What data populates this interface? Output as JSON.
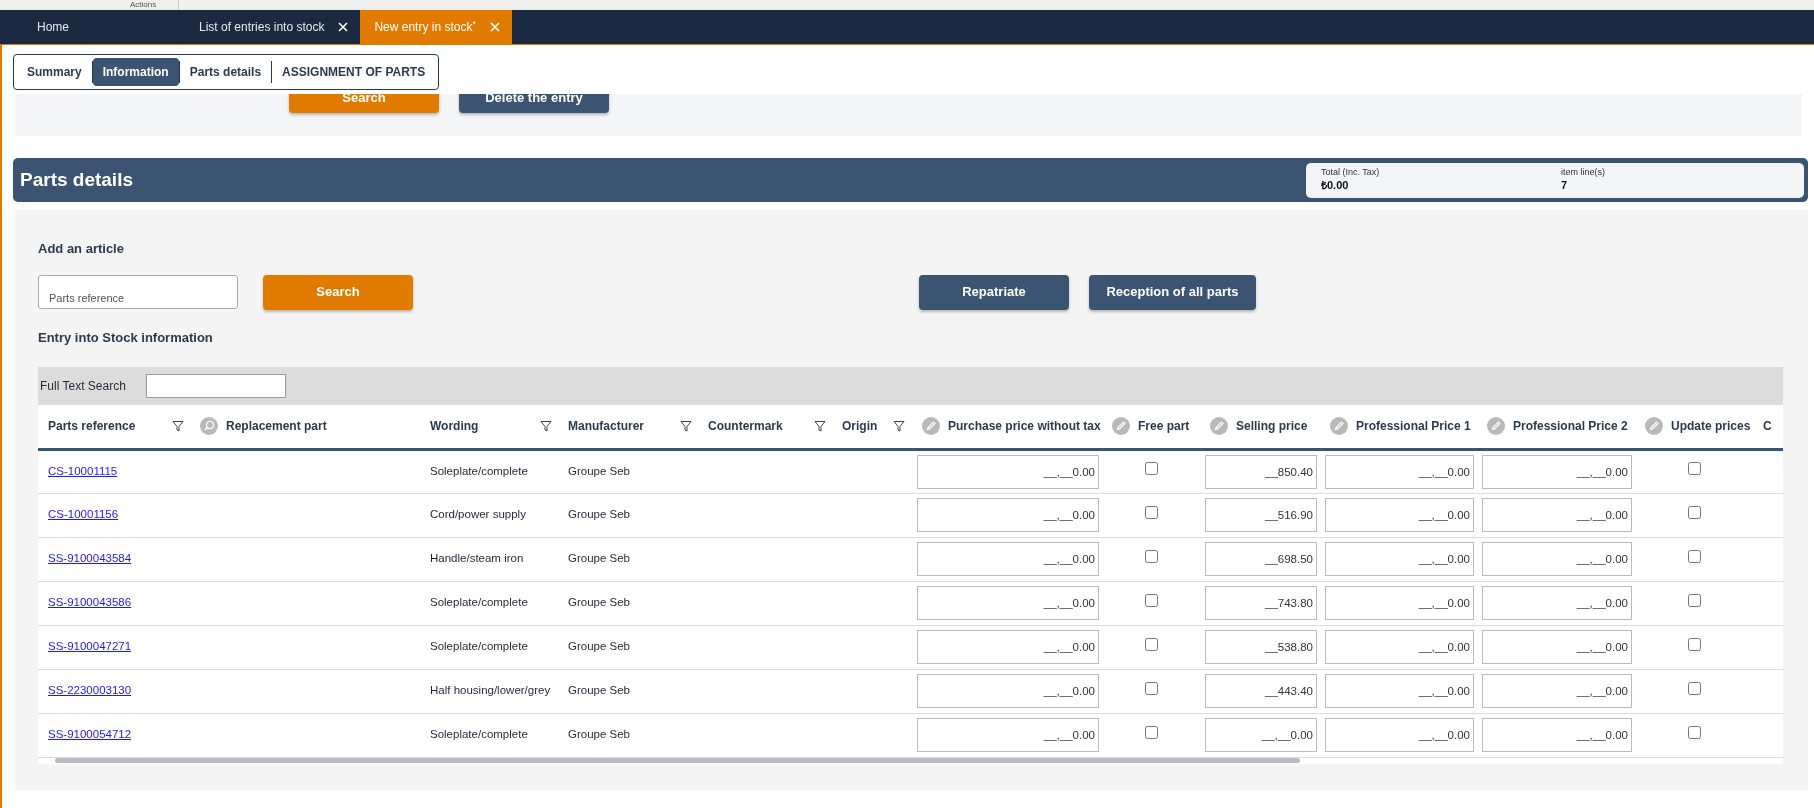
{
  "top_strip": {
    "label": "Actions"
  },
  "tabs": [
    {
      "label": "Home",
      "closable": false,
      "selected": false
    },
    {
      "label": "List of entries into stock",
      "closable": true,
      "selected": false
    },
    {
      "label": "New entry in stock$^{*}$",
      "closable": true,
      "selected": true
    }
  ],
  "section_nav": [
    {
      "label": "Summary",
      "selected": false
    },
    {
      "label": "Information",
      "selected": true
    },
    {
      "label": "Parts details",
      "selected": false
    },
    {
      "label": "ASSIGNMENT OF PARTS",
      "selected": false
    }
  ],
  "top_actions": [
    {
      "label": "Search",
      "kind": "primary"
    },
    {
      "label": "Delete the entry",
      "kind": "secondary"
    }
  ],
  "parts_details": {
    "title": "Parts details",
    "summary": [
      {
        "label": "Total (Inc. Tax)",
        "value": "₺0.00"
      },
      {
        "label": "item line(s)",
        "value": "7"
      }
    ]
  },
  "add_article": {
    "title": "Add an article",
    "field": {
      "placeholder": "Parts reference"
    },
    "search_button": "Search",
    "buttons": [
      "Repatriate",
      "Reception of all parts"
    ]
  },
  "grid": {
    "title": "Entry into Stock information",
    "full_text_search": {
      "label": "Full Text Search"
    },
    "columns": [
      {
        "label": "Parts reference",
        "kind": "filterable"
      },
      {
        "label": "Replacement part",
        "kind": "lookup"
      },
      {
        "label": "Wording",
        "kind": "filterable"
      },
      {
        "label": "Manufacturer",
        "kind": "filterable"
      },
      {
        "label": "Countermark",
        "kind": "filterable"
      },
      {
        "label": "Origin",
        "kind": "filterable"
      },
      {
        "label": "Purchase price without tax",
        "kind": "editable"
      },
      {
        "label": "Free part",
        "kind": "editable"
      },
      {
        "label": "Selling price",
        "kind": "editable"
      },
      {
        "label": "Professional Price 1",
        "kind": "editable"
      },
      {
        "label": "Professional Price 2",
        "kind": "editable"
      },
      {
        "label": "Update prices",
        "kind": "editable"
      },
      {
        "label": "C",
        "kind": "plain"
      }
    ],
    "rows": [
      {
        "parts_reference": "CS-10001115",
        "wording": "Soleplate/complete",
        "manufacturer": "Groupe Seb",
        "purchase_price": "__,__0.00",
        "free_part": false,
        "selling_price": "__850.40",
        "professional_price_1": "__,__0.00",
        "professional_price_2": "__,__0.00",
        "update_prices": false
      },
      {
        "parts_reference": "CS-10001156",
        "wording": "Cord/power supply",
        "manufacturer": "Groupe Seb",
        "purchase_price": "__,__0.00",
        "free_part": false,
        "selling_price": "__516.90",
        "professional_price_1": "__,__0.00",
        "professional_price_2": "__,__0.00",
        "update_prices": false
      },
      {
        "parts_reference": "SS-9100043584",
        "wording": "Handle/steam iron",
        "manufacturer": "Groupe Seb",
        "purchase_price": "__,__0.00",
        "free_part": false,
        "selling_price": "__698.50",
        "professional_price_1": "__,__0.00",
        "professional_price_2": "__,__0.00",
        "update_prices": false
      },
      {
        "parts_reference": "SS-9100043586",
        "wording": "Soleplate/complete",
        "manufacturer": "Groupe Seb",
        "purchase_price": "__,__0.00",
        "free_part": false,
        "selling_price": "__743.80",
        "professional_price_1": "__,__0.00",
        "professional_price_2": "__,__0.00",
        "update_prices": false
      },
      {
        "parts_reference": "SS-9100047271",
        "wording": "Soleplate/complete",
        "manufacturer": "Groupe Seb",
        "purchase_price": "__,__0.00",
        "free_part": false,
        "selling_price": "__538.80",
        "professional_price_1": "__,__0.00",
        "professional_price_2": "__,__0.00",
        "update_prices": false
      },
      {
        "parts_reference": "SS-2230003130",
        "wording": "Half housing/lower/grey",
        "manufacturer": "Groupe Seb",
        "purchase_price": "__,__0.00",
        "free_part": false,
        "selling_price": "__443.40",
        "professional_price_1": "__,__0.00",
        "professional_price_2": "__,__0.00",
        "update_prices": false
      },
      {
        "parts_reference": "SS-9100054712",
        "wording": "Soleplate/complete",
        "manufacturer": "Groupe Seb",
        "purchase_price": "__,__0.00",
        "free_part": false,
        "selling_price": "__,__0.00",
        "professional_price_1": "__,__0.00",
        "professional_price_2": "__,__0.00",
        "update_prices": false
      }
    ]
  }
}
